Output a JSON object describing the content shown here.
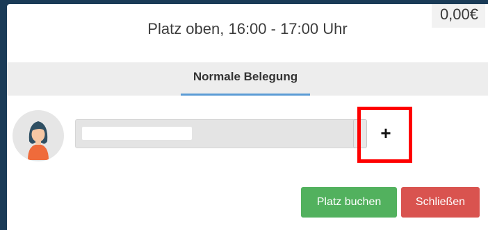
{
  "header": {
    "price": "0,00€",
    "slot_title": "Platz oben, 16:00 - 17:00 Uhr"
  },
  "tabs": [
    {
      "label": "Normale Belegung",
      "active": true
    }
  ],
  "player": {
    "input_value": "",
    "avatar_icon": "female-avatar-icon",
    "add_label": "+",
    "add_icon": "plus-icon"
  },
  "actions": {
    "book_label": "Platz buchen",
    "close_label": "Schließen"
  },
  "colors": {
    "book_button": "#52b15e",
    "close_button": "#d9534f",
    "tab_underline": "#5b9bd5",
    "highlight_frame": "#ff0000",
    "backdrop": "#1a3b57"
  }
}
